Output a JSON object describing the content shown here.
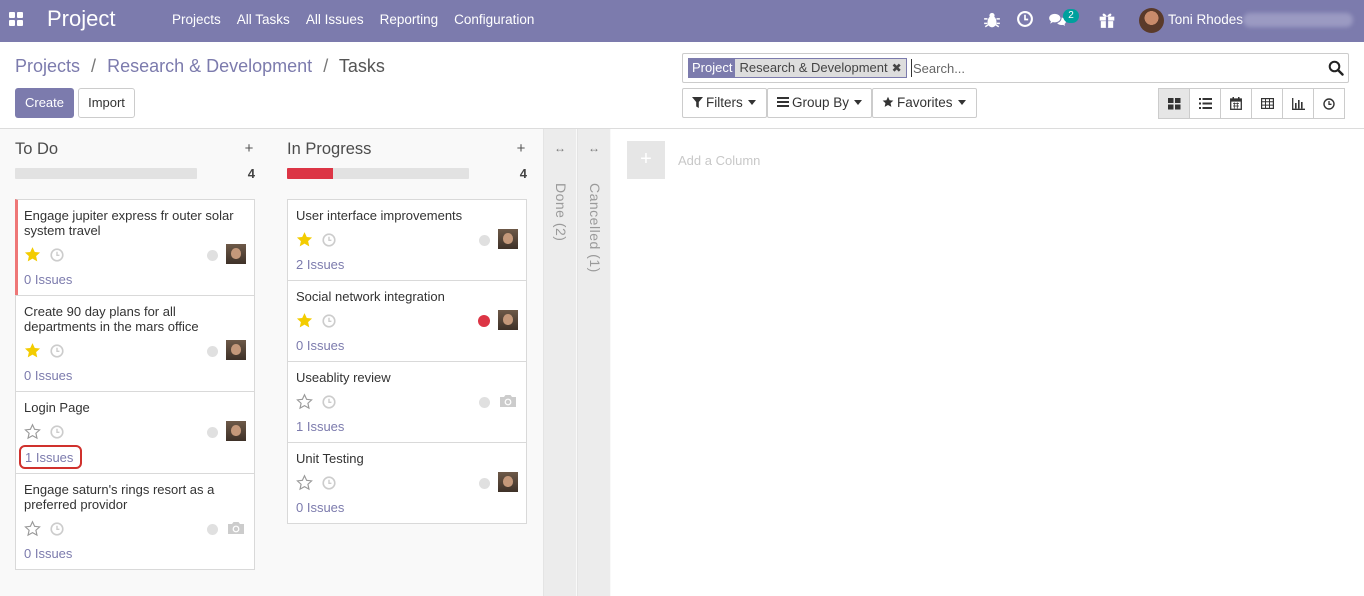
{
  "navbar": {
    "brand": "Project",
    "menu": [
      "Projects",
      "All Tasks",
      "All Issues",
      "Reporting",
      "Configuration"
    ],
    "chat_badge": "2",
    "user_name": "Toni Rhodes",
    "icons": [
      "apps-icon",
      "bug-icon",
      "clock-icon",
      "chat-icon",
      "gift-icon"
    ]
  },
  "breadcrumb": {
    "projects": "Projects",
    "sep": "/",
    "project": "Research & Development",
    "current": "Tasks"
  },
  "buttons": {
    "create": "Create",
    "import": "Import"
  },
  "search": {
    "facet_label": "Project",
    "facet_value": "Research & Development",
    "facet_close": "✖",
    "placeholder": "Search..."
  },
  "dropdowns": {
    "filters": "Filters",
    "group_by": "Group By",
    "favorites": "Favorites"
  },
  "views": [
    "kanban-view",
    "list-view",
    "calendar-view",
    "pivot-view",
    "graph-view",
    "activity-view"
  ],
  "colors": {
    "brand": "#7c7bad",
    "accent": "#00a09d",
    "danger": "#dc3545",
    "star": "#f3cc00"
  },
  "columns": [
    {
      "title": "To Do",
      "count": "4",
      "progress_red": 0,
      "cards": [
        {
          "title": "Engage jupiter express fr outer solar system travel",
          "starred": true,
          "dot": "grey",
          "avatar": "person",
          "issues": "0 Issues",
          "blocked": true
        },
        {
          "title": "Create 90 day plans for all departments in the mars office",
          "starred": true,
          "dot": "grey",
          "avatar": "person",
          "issues": "0 Issues"
        },
        {
          "title": "Login Page",
          "starred": false,
          "dot": "grey",
          "avatar": "person",
          "issues": "1 Issues",
          "highlight": true
        },
        {
          "title": "Engage saturn's rings resort as a preferred providor",
          "starred": false,
          "dot": "grey",
          "avatar": "camera",
          "issues": "0 Issues"
        }
      ]
    },
    {
      "title": "In Progress",
      "count": "4",
      "progress_red": 0.25,
      "cards": [
        {
          "title": "User interface improvements",
          "starred": true,
          "dot": "grey",
          "avatar": "person",
          "issues": "2 Issues"
        },
        {
          "title": "Social network integration",
          "starred": true,
          "dot": "red",
          "avatar": "person",
          "issues": "0 Issues"
        },
        {
          "title": "Useablity review",
          "starred": false,
          "dot": "grey",
          "avatar": "camera",
          "issues": "1 Issues"
        },
        {
          "title": "Unit Testing",
          "starred": false,
          "dot": "grey",
          "avatar": "person",
          "issues": "0 Issues"
        }
      ]
    }
  ],
  "folded": [
    {
      "title": "Done (2)",
      "expand": "↔"
    },
    {
      "title": "Cancelled (1)",
      "expand": "↔"
    }
  ],
  "add_column": {
    "plus": "+",
    "label": "Add a Column"
  }
}
